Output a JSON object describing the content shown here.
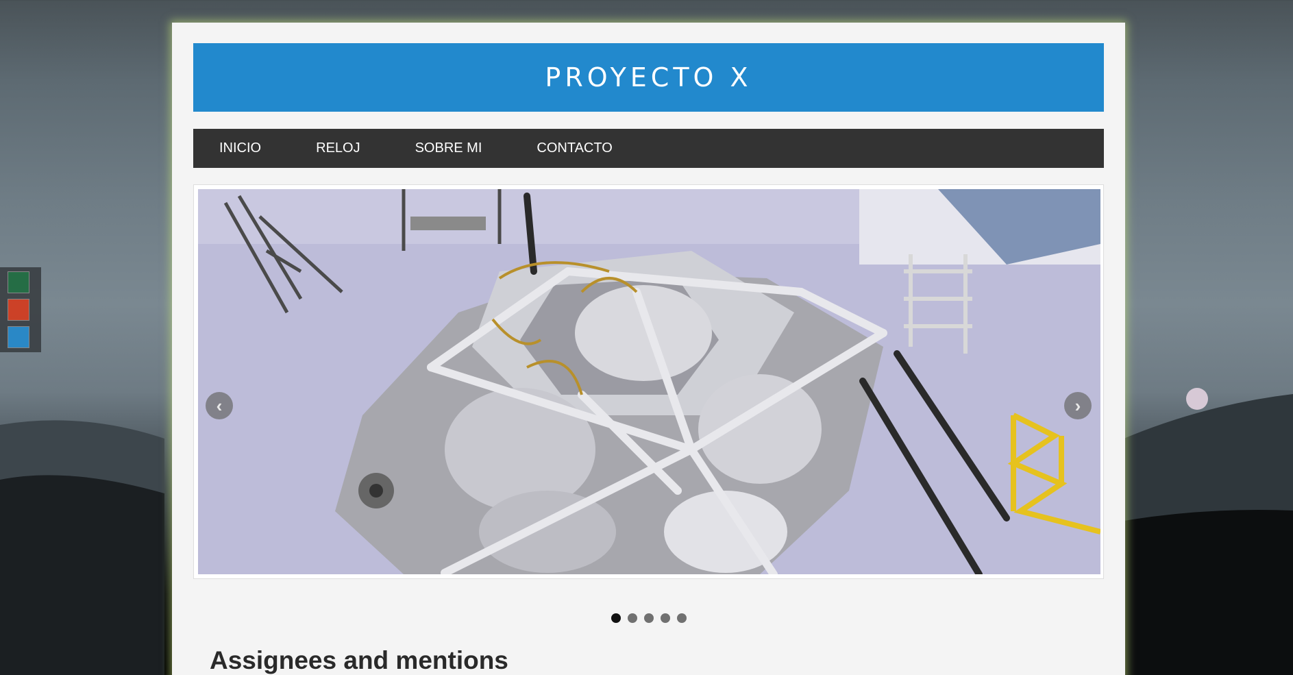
{
  "site": {
    "title": "PROYECTO X"
  },
  "nav": {
    "items": [
      {
        "label": "INICIO"
      },
      {
        "label": "RELOJ"
      },
      {
        "label": "SOBRE MI"
      },
      {
        "label": "CONTACTO"
      }
    ]
  },
  "theme_switcher": {
    "colors": [
      "#1d6b3e",
      "#d53a1c",
      "#2289cd"
    ]
  },
  "carousel": {
    "prev_icon": "chevron-left-icon",
    "next_icon": "chevron-right-icon",
    "slide_count": 5,
    "active_slide": 1,
    "prev_glyph": "‹",
    "next_glyph": "›"
  },
  "main": {
    "section_title": "Assignees and mentions"
  },
  "colors": {
    "banner": "#2289cd",
    "nav": "#333333",
    "page": "#f4f4f4"
  }
}
